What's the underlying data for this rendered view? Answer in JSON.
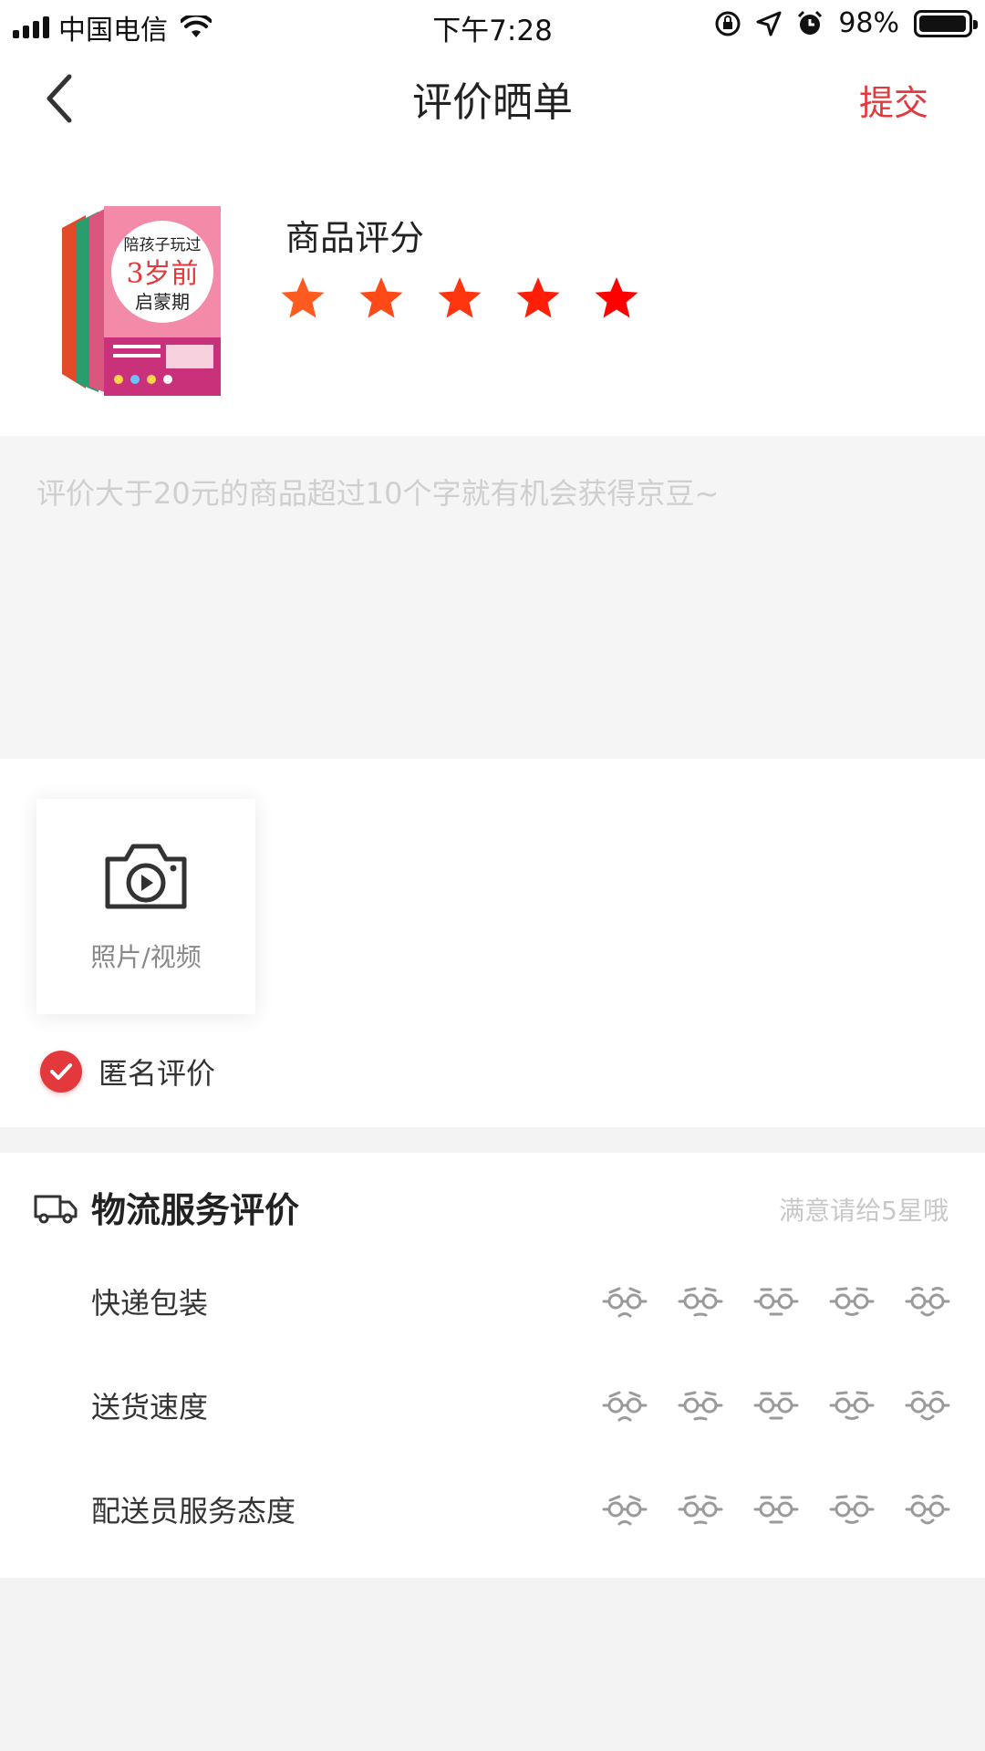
{
  "status_bar": {
    "carrier": "中国电信",
    "time": "下午7:28",
    "battery": "98%",
    "battery_level": 0.98
  },
  "nav": {
    "title": "评价晒单",
    "submit_label": "提交",
    "back_icon": "chevron-left-icon"
  },
  "product": {
    "score_label": "商品评分",
    "rating": 5,
    "max_rating": 5,
    "book_cover_text": [
      "陪孩子玩过",
      "3岁前",
      "启蒙期"
    ]
  },
  "review": {
    "placeholder": "评价大于20元的商品超过10个字就有机会获得京豆~",
    "value": ""
  },
  "upload": {
    "label": "照片/视频",
    "icon": "camera-video-icon"
  },
  "anonymous": {
    "label": "匿名评价",
    "checked": true
  },
  "logistics": {
    "title": "物流服务评价",
    "hint": "满意请给5星哦",
    "icon": "truck-icon",
    "rows": [
      {
        "label": "快递包装"
      },
      {
        "label": "送货速度"
      },
      {
        "label": "配送员服务态度"
      }
    ]
  },
  "colors": {
    "accent": "#e4393c",
    "star_gradient": [
      "#ff5a1f",
      "#ff0000"
    ],
    "face_gray": "#9a9a9a"
  }
}
